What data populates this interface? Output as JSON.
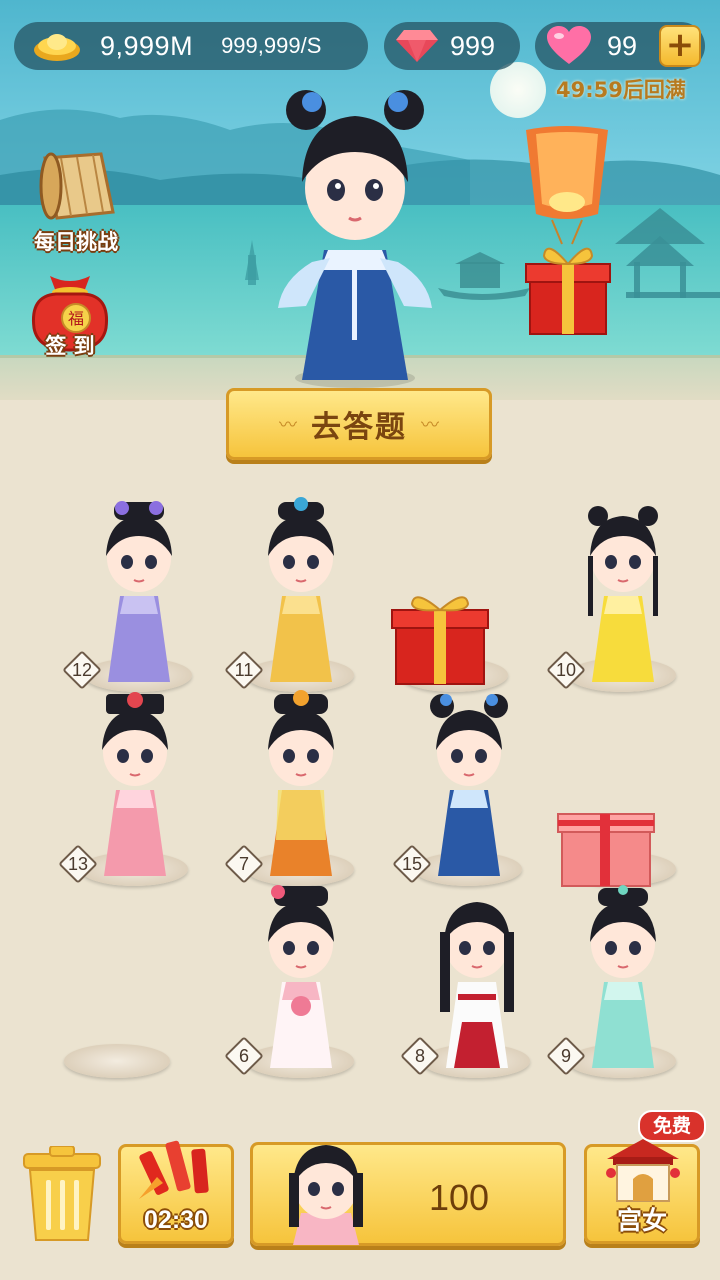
{
  "hud": {
    "gold": "9,999M",
    "gold_rate": "999,999/S",
    "gems": "999",
    "hearts": "99",
    "plus_label": "+",
    "refill_timer": "49:59后回满"
  },
  "side_buttons": {
    "daily_challenge": "每日挑战",
    "sign_in": "签 到",
    "sign_in_bag_char": "福"
  },
  "answer_button": {
    "label": "去答题",
    "deco": "〰"
  },
  "grid": {
    "slots": [
      {
        "level": "12",
        "content": "girl",
        "dress": "lavender"
      },
      {
        "level": "11",
        "content": "girl",
        "dress": "yellow"
      },
      {
        "level": "",
        "content": "gift-red"
      },
      {
        "level": "10",
        "content": "girl",
        "dress": "lemon"
      },
      {
        "level": "13",
        "content": "girl",
        "dress": "pink"
      },
      {
        "level": "7",
        "content": "girl",
        "dress": "orange"
      },
      {
        "level": "15",
        "content": "girl",
        "dress": "blue"
      },
      {
        "level": "",
        "content": "gift-pink"
      },
      {
        "level": "",
        "content": "empty"
      },
      {
        "level": "6",
        "content": "girl",
        "dress": "white-pink"
      },
      {
        "level": "8",
        "content": "girl",
        "dress": "white-red"
      },
      {
        "level": "9",
        "content": "girl",
        "dress": "mint"
      }
    ]
  },
  "bottom_bar": {
    "fireworks_timer": "02:30",
    "buy_price": "100",
    "palace_label": "宫女",
    "free_badge": "免费"
  },
  "colors": {
    "gold_button": "#f6c43c",
    "gold_border": "#d79a26",
    "hud_pill": "#285868",
    "badge_red": "#d9322b"
  }
}
